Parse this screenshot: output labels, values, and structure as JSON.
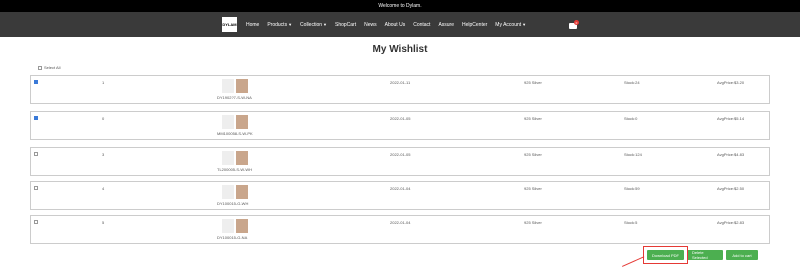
{
  "topbar": {
    "text": "Welcome to Dylam."
  },
  "nav": {
    "logo": "DYLAM",
    "items": [
      {
        "label": "Home",
        "caret": false
      },
      {
        "label": "Products",
        "caret": true
      },
      {
        "label": "Collection",
        "caret": true
      },
      {
        "label": "ShopCart",
        "caret": false
      },
      {
        "label": "News",
        "caret": false
      },
      {
        "label": "About Us",
        "caret": false
      },
      {
        "label": "Contact",
        "caret": false
      },
      {
        "label": "Assure",
        "caret": false
      },
      {
        "label": "HelpCenter",
        "caret": false
      },
      {
        "label": "My Account",
        "caret": true
      }
    ],
    "cart_count": "0"
  },
  "page": {
    "title": "My Wishlist",
    "select_all": "Select All"
  },
  "rows": [
    {
      "checked": true,
      "index": "1",
      "sku": "DY1902?7-S-W-NA",
      "date": "2022-01-11",
      "material": "925 Silver",
      "stock": "Stock:24",
      "price": "AvgPrice:$3.20"
    },
    {
      "checked": true,
      "index": "0",
      "sku": "MM100058-S-W-PK",
      "date": "2022-01-05",
      "material": "925 Silver",
      "stock": "Stock:0",
      "price": "AvgPrice:$5.14"
    },
    {
      "checked": false,
      "index": "3",
      "sku": "TL200005-S-W-WH",
      "date": "2022-01-05",
      "material": "925 Silver",
      "stock": "Stock:124",
      "price": "AvgPrice:$4.83"
    },
    {
      "checked": false,
      "index": "4",
      "sku": "DY100015-G-WH",
      "date": "2022-01-04",
      "material": "925 Silver",
      "stock": "Stock:59",
      "price": "AvgPrice:$2.50"
    },
    {
      "checked": false,
      "index": "5",
      "sku": "DY100015-G-NA",
      "date": "2022-01-04",
      "material": "925 Silver",
      "stock": "Stock:5",
      "price": "AvgPrice:$2.83"
    }
  ],
  "actions": {
    "download_pdf": "Download PDF",
    "delete_selected": "Delete Selected",
    "add_to_cart": "Add to cart"
  }
}
